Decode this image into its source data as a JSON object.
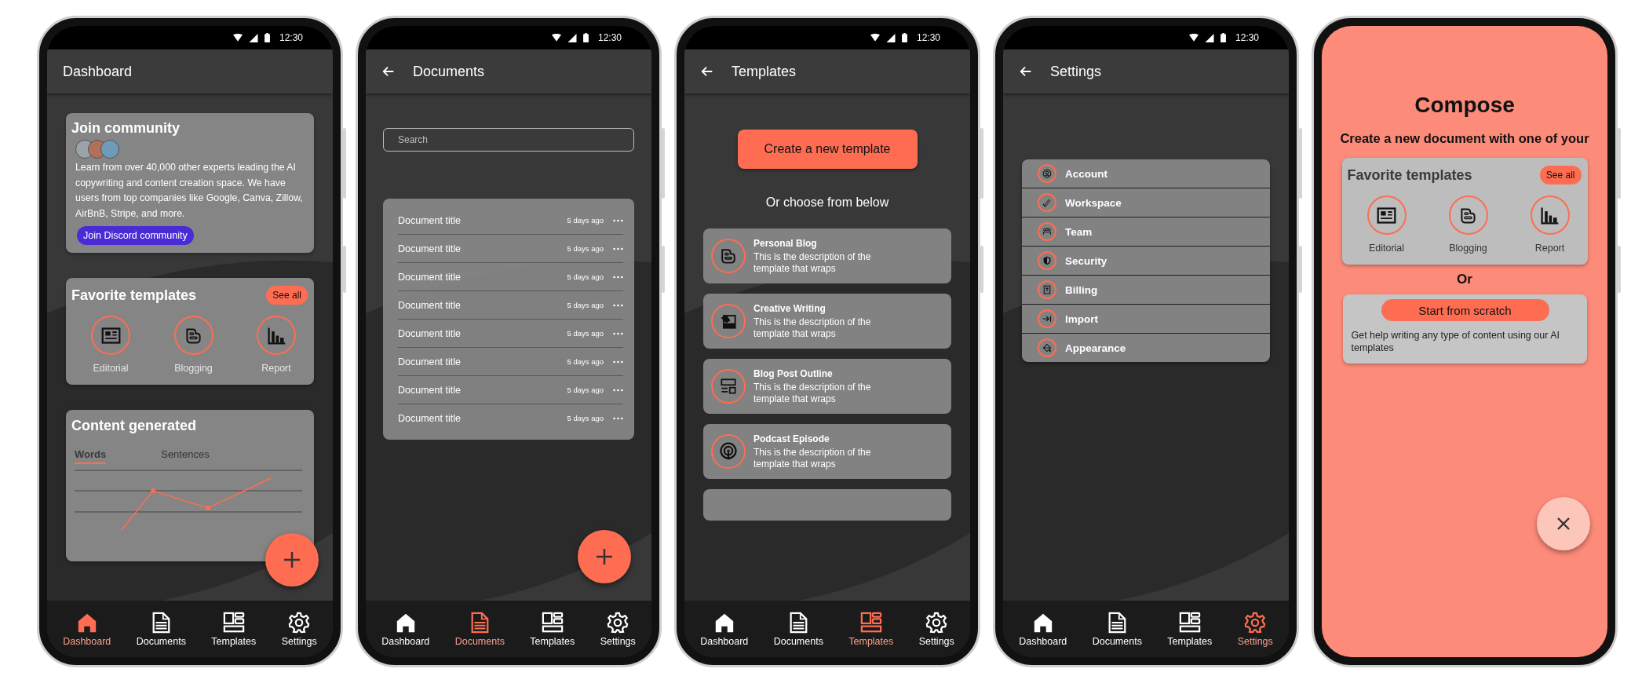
{
  "dashboard": {
    "status_time": "12:30",
    "title": "Dashboard",
    "community": {
      "title": "Join community",
      "text": "Learn from over 40,000 other experts leading the AI copywriting and content creation space. We have users from top companies like Google, Canva, Zillow, AirBnB, Stripe, and more.",
      "button": "Join Discord community"
    },
    "favorites": {
      "title": "Favorite templates",
      "see_all": "See all",
      "items": [
        {
          "label": "Editorial"
        },
        {
          "label": "Blogging"
        },
        {
          "label": "Report"
        }
      ]
    },
    "content_generated": {
      "title": "Content generated",
      "tabs": [
        {
          "label": "Words",
          "selected": true
        },
        {
          "label": "Sentences",
          "selected": false
        }
      ]
    },
    "nav": [
      {
        "label": "Dashboard",
        "selected": true
      },
      {
        "label": "Documents",
        "selected": false
      },
      {
        "label": "Templates",
        "selected": false
      },
      {
        "label": "Settings",
        "selected": false
      }
    ]
  },
  "documents": {
    "status_time": "12:30",
    "title": "Documents",
    "search": {
      "placeholder": "Search"
    },
    "rows": [
      {
        "title": "Document title",
        "time": "5 days ago"
      },
      {
        "title": "Document title",
        "time": "5 days ago"
      },
      {
        "title": "Document title",
        "time": "5 days ago"
      },
      {
        "title": "Document title",
        "time": "5 days ago"
      },
      {
        "title": "Document title",
        "time": "5 days ago"
      },
      {
        "title": "Document title",
        "time": "5 days ago"
      },
      {
        "title": "Document title",
        "time": "5 days ago"
      },
      {
        "title": "Document title",
        "time": "5 days ago"
      }
    ],
    "nav": [
      {
        "label": "Dashboard",
        "selected": false
      },
      {
        "label": "Documents",
        "selected": true
      },
      {
        "label": "Templates",
        "selected": false
      },
      {
        "label": "Settings",
        "selected": false
      }
    ]
  },
  "templates": {
    "status_time": "12:30",
    "title": "Templates",
    "create_button": "Create a new template",
    "subtitle": "Or choose from below",
    "items": [
      {
        "name": "Personal Blog",
        "description": "This is the description of the template that wraps"
      },
      {
        "name": "Creative Writing",
        "description": "This is the description of the template that wraps"
      },
      {
        "name": "Blog Post Outline",
        "description": "This is the description of the template that wraps"
      },
      {
        "name": "Podcast Episode",
        "description": "This is the description of the template that wraps"
      }
    ],
    "nav": [
      {
        "label": "Dashboard",
        "selected": false
      },
      {
        "label": "Documents",
        "selected": false
      },
      {
        "label": "Templates",
        "selected": true
      },
      {
        "label": "Settings",
        "selected": false
      }
    ]
  },
  "settings": {
    "status_time": "12:30",
    "title": "Settings",
    "items": [
      {
        "label": "Account"
      },
      {
        "label": "Workspace"
      },
      {
        "label": "Team"
      },
      {
        "label": "Security"
      },
      {
        "label": "Billing"
      },
      {
        "label": "Import"
      },
      {
        "label": "Appearance"
      }
    ],
    "nav": [
      {
        "label": "Dashboard",
        "selected": false
      },
      {
        "label": "Documents",
        "selected": false
      },
      {
        "label": "Templates",
        "selected": false
      },
      {
        "label": "Settings",
        "selected": true
      }
    ]
  },
  "compose": {
    "title": "Compose",
    "subtitle": "Create a new document with one of your",
    "favorites": {
      "title": "Favorite templates",
      "see_all": "See all",
      "items": [
        {
          "label": "Editorial"
        },
        {
          "label": "Blogging"
        },
        {
          "label": "Report"
        }
      ]
    },
    "or": "Or",
    "scratch": {
      "button": "Start from scratch",
      "text": "Get help writing any type of content using our AI templates"
    }
  }
}
